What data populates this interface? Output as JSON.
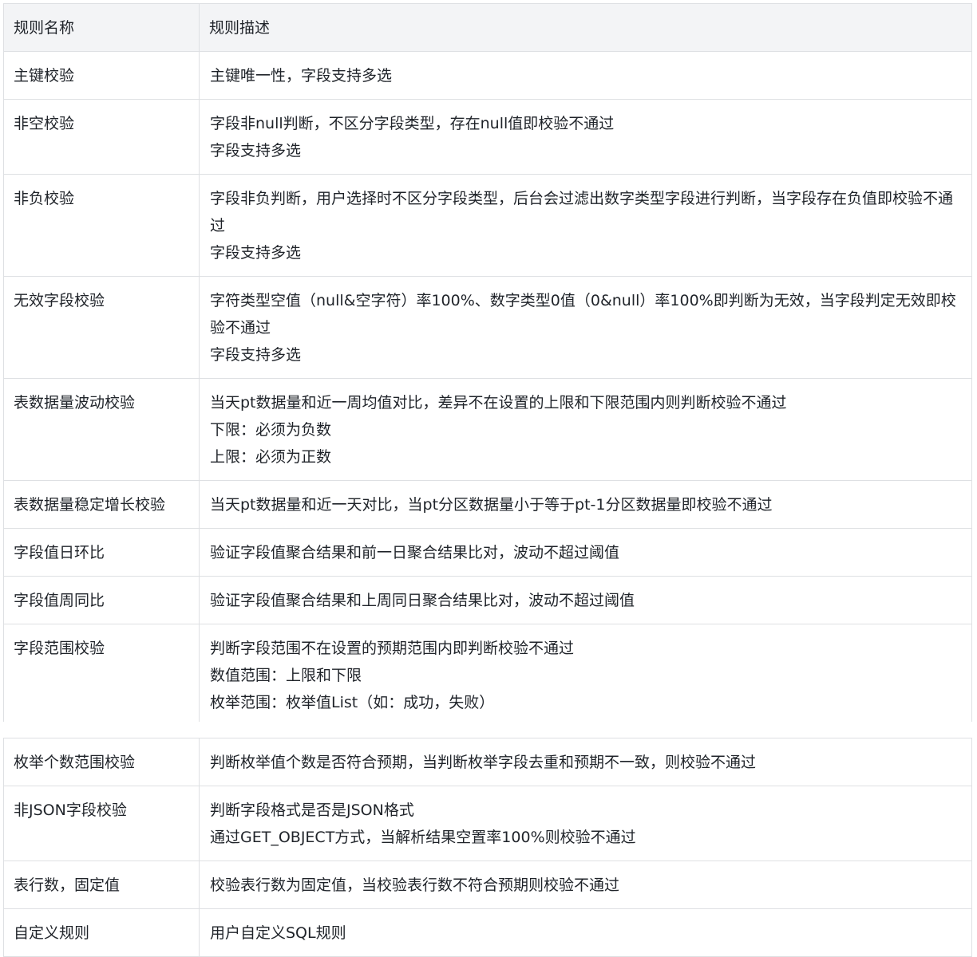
{
  "table": {
    "header": {
      "name": "规则名称",
      "description": "规则描述"
    },
    "part1": [
      {
        "name": "主键校验",
        "lines": [
          "主键唯一性，字段支持多选"
        ]
      },
      {
        "name": "非空校验",
        "lines": [
          "字段非null判断，不区分字段类型，存在null值即校验不通过",
          "字段支持多选"
        ]
      },
      {
        "name": "非负校验",
        "lines": [
          "字段非负判断，用户选择时不区分字段类型，后台会过滤出数字类型字段进行判断，当字段存在负值即校验不通过",
          "字段支持多选"
        ]
      },
      {
        "name": "无效字段校验",
        "lines": [
          "字符类型空值（null&空字符）率100%、数字类型0值（0&null）率100%即判断为无效，当字段判定无效即校验不通过",
          "字段支持多选"
        ]
      },
      {
        "name": "表数据量波动校验",
        "lines": [
          "当天pt数据量和近一周均值对比，差异不在设置的上限和下限范围内则判断校验不通过",
          "下限：必须为负数",
          "上限：必须为正数"
        ]
      },
      {
        "name": "表数据量稳定增长校验",
        "lines": [
          "当天pt数据量和近一天对比，当pt分区数据量小于等于pt-1分区数据量即校验不通过"
        ]
      },
      {
        "name": "字段值日环比",
        "lines": [
          "验证字段值聚合结果和前一日聚合结果比对，波动不超过阈值"
        ]
      },
      {
        "name": "字段值周同比",
        "lines": [
          "验证字段值聚合结果和上周同日聚合结果比对，波动不超过阈值"
        ]
      },
      {
        "name": "字段范围校验",
        "lines": [
          "判断字段范围不在设置的预期范围内即判断校验不通过",
          "数值范围：上限和下限",
          "枚举范围：枚举值List（如：成功，失败）"
        ]
      }
    ],
    "part2": [
      {
        "name": "枚举个数范围校验",
        "lines": [
          "判断枚举值个数是否符合预期，当判断枚举字段去重和预期不一致，则校验不通过"
        ]
      },
      {
        "name": "非JSON字段校验",
        "lines": [
          "判断字段格式是否是JSON格式",
          "通过GET_OBJECT方式，当解析结果空置率100%则校验不通过"
        ]
      },
      {
        "name": "表行数，固定值",
        "lines": [
          "校验表行数为固定值，当校验表行数不符合预期则校验不通过"
        ]
      },
      {
        "name": "自定义规则",
        "lines": [
          "用户自定义SQL规则"
        ]
      }
    ]
  }
}
